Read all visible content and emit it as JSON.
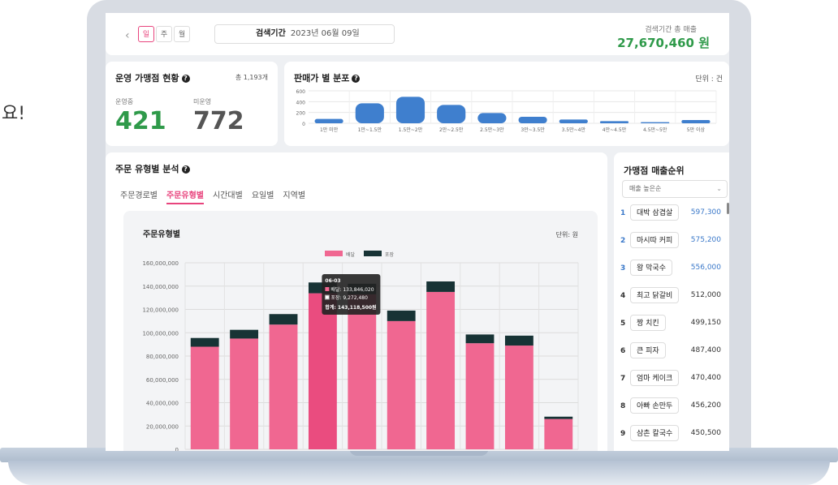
{
  "outside_text": "요!",
  "topbar": {
    "period_tabs": [
      "일",
      "주",
      "월"
    ],
    "search_label": "검색기간",
    "search_date": "2023년 06월 09일",
    "total_label": "검색기간 총 매출",
    "total_value": "27,670,460 원"
  },
  "status": {
    "title": "운영 가맹점 현황",
    "total": "총 1,193개",
    "operating_label": "운영중",
    "operating_value": "421",
    "closed_label": "미운영",
    "closed_value": "772"
  },
  "price_distribution": {
    "title": "판매가 별 분포",
    "unit": "단위 : 건"
  },
  "order_analysis": {
    "title": "주문 유형별 분석",
    "tabs": [
      "주문경로별",
      "주문유형별",
      "시간대별",
      "요일별",
      "지역별"
    ],
    "active_tab": 1
  },
  "ranking": {
    "title": "가맹점 매출순위",
    "sort_label": "매출 높은순",
    "items": [
      {
        "rank": "1",
        "name": "대박 삼겹살",
        "value": "597,300",
        "color": "#3a78c9"
      },
      {
        "rank": "2",
        "name": "마시따 커피",
        "value": "575,200",
        "color": "#3a78c9"
      },
      {
        "rank": "3",
        "name": "왕 막국수",
        "value": "556,000",
        "color": "#3a78c9"
      },
      {
        "rank": "4",
        "name": "최고 닭갈비",
        "value": "512,000",
        "color": "#333333"
      },
      {
        "rank": "5",
        "name": "짱 치킨",
        "value": "499,150",
        "color": "#333333"
      },
      {
        "rank": "6",
        "name": "큰 피자",
        "value": "487,400",
        "color": "#333333"
      },
      {
        "rank": "7",
        "name": "엄마 케이크",
        "value": "470,400",
        "color": "#333333"
      },
      {
        "rank": "8",
        "name": "아빠 손만두",
        "value": "456,200",
        "color": "#333333"
      },
      {
        "rank": "9",
        "name": "삼촌 칼국수",
        "value": "450,500",
        "color": "#333333"
      }
    ]
  },
  "colors": {
    "accent_pink": "#e8447d",
    "bar_pink": "#f06791",
    "bar_pink_highlight": "#ea4c7f",
    "bar_dark": "#173335",
    "price_blue": "#3f7fce",
    "green": "#2f9a4a"
  },
  "chart_data": [
    {
      "type": "bar",
      "title": "판매가 별 분포",
      "unit": "단위 : 건",
      "categories": [
        "1만 미만",
        "1만~1.5만",
        "1.5만~2만",
        "2만~2.5만",
        "2.5만~3만",
        "3만~3.5만",
        "3.5만~4만",
        "4만~4.5만",
        "4.5만~5만",
        "5만 이상"
      ],
      "values": [
        80,
        370,
        490,
        340,
        190,
        120,
        70,
        40,
        20,
        60
      ],
      "y_ticks": [
        "600",
        "400",
        "200",
        "0"
      ],
      "ylim": [
        0,
        600
      ],
      "grid": true
    },
    {
      "type": "bar",
      "stacked": true,
      "title": "주문유형별",
      "unit": "단위: 원",
      "categories": [
        "",
        "",
        "",
        "06-03",
        "",
        "",
        "",
        "",
        "",
        ""
      ],
      "series": [
        {
          "name": "배달",
          "values": [
            88000000,
            95000000,
            107000000,
            133846020,
            133000000,
            110000000,
            135000000,
            91000000,
            89000000,
            26000000
          ]
        },
        {
          "name": "포장",
          "values": [
            7500000,
            7500000,
            9000000,
            9272480,
            9000000,
            9000000,
            9000000,
            7500000,
            8500000,
            2000000
          ]
        }
      ],
      "y_ticks": [
        "160,000,000",
        "140,000,000",
        "120,000,000",
        "100,000,000",
        "80,000,000",
        "60,000,000",
        "40,000,000",
        "20,000,000",
        "0"
      ],
      "ylim": [
        0,
        160000000
      ],
      "grid": true,
      "legend": "top-center",
      "highlight_index": 3,
      "tooltip": {
        "title": "06-03",
        "line1": "배달: 133,846,020",
        "line2": "포장: 9,272,480",
        "total": "합계: 143,118,500원"
      }
    }
  ]
}
